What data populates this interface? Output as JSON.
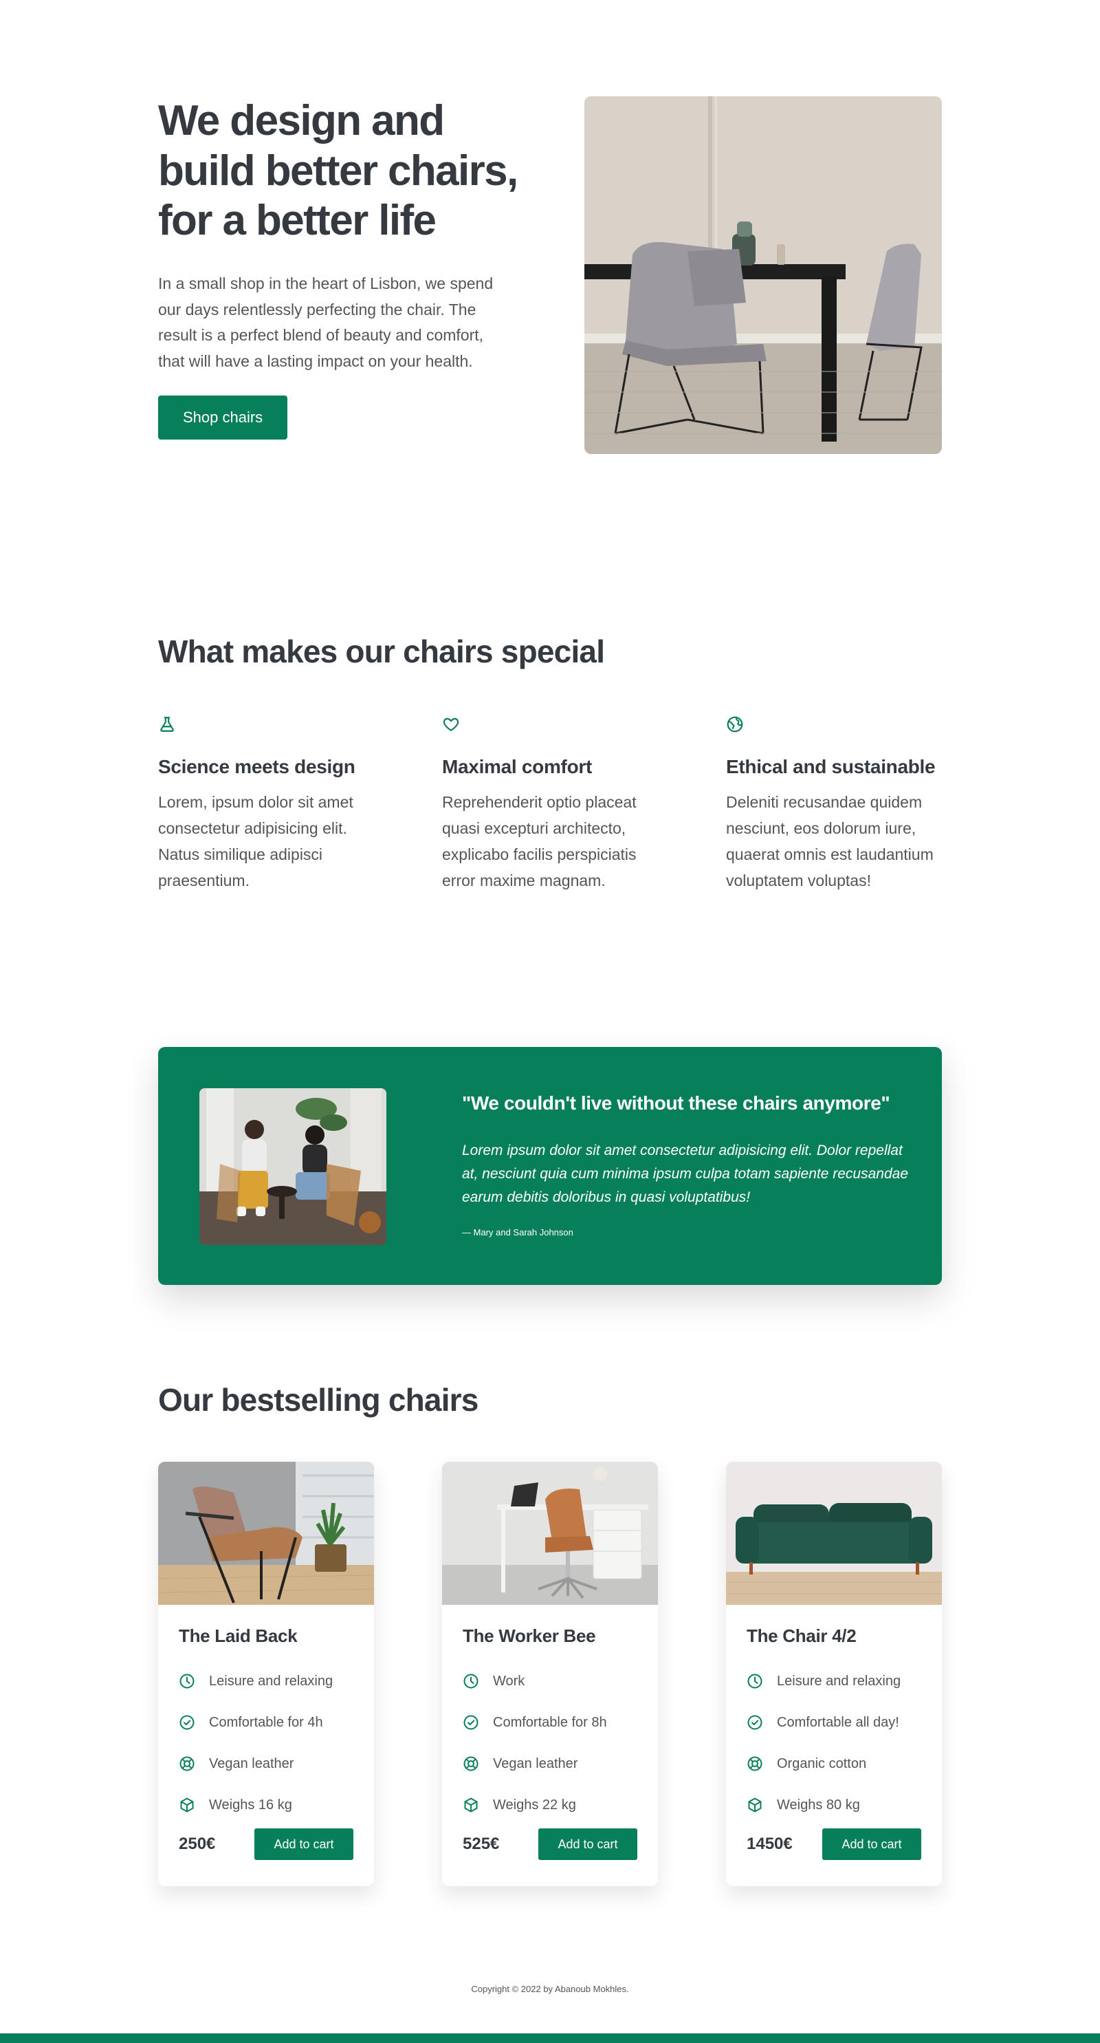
{
  "hero": {
    "title": "We design and build better chairs, for a better life",
    "description": "In a small shop in the heart of Lisbon, we spend our days relentlessly perfecting the chair. The result is a perfect blend of beauty and comfort, that will have a lasting impact on your health.",
    "cta_label": "Shop chairs"
  },
  "features": {
    "title": "What makes our chairs special",
    "items": [
      {
        "icon": "flask-icon",
        "title": "Science meets design",
        "description": "Lorem, ipsum dolor sit amet consectetur adipisicing elit. Natus similique adipisci praesentium."
      },
      {
        "icon": "heart-icon",
        "title": "Maximal comfort",
        "description": "Reprehenderit optio placeat quasi excepturi architecto, explicabo facilis perspiciatis error maxime magnam."
      },
      {
        "icon": "globe-icon",
        "title": "Ethical and sustainable",
        "description": "Deleniti recusandae quidem nesciunt, eos dolorum iure, quaerat omnis est laudantium voluptatem voluptas!"
      }
    ]
  },
  "testimonial": {
    "quote": "\"We couldn't live without these chairs anymore\"",
    "text": "Lorem ipsum dolor sit amet consectetur adipisicing elit. Dolor repellat at, nesciunt quia cum minima ipsum culpa totam sapiente recusandae earum debitis doloribus in quasi voluptatibus!",
    "author": "— Mary and Sarah Johnson"
  },
  "products": {
    "title": "Our bestselling chairs",
    "items": [
      {
        "name": "The Laid Back",
        "attributes": [
          {
            "icon": "clock-icon",
            "text": "Leisure and relaxing"
          },
          {
            "icon": "check-circle-icon",
            "text": "Comfortable for 4h"
          },
          {
            "icon": "lifebuoy-icon",
            "text": "Vegan leather"
          },
          {
            "icon": "cube-icon",
            "text": "Weighs 16 kg"
          }
        ],
        "price": "250€",
        "button_label": "Add to cart"
      },
      {
        "name": "The Worker Bee",
        "attributes": [
          {
            "icon": "clock-icon",
            "text": "Work"
          },
          {
            "icon": "check-circle-icon",
            "text": "Comfortable for 8h"
          },
          {
            "icon": "lifebuoy-icon",
            "text": "Vegan leather"
          },
          {
            "icon": "cube-icon",
            "text": "Weighs 22 kg"
          }
        ],
        "price": "525€",
        "button_label": "Add to cart"
      },
      {
        "name": "The Chair 4/2",
        "attributes": [
          {
            "icon": "clock-icon",
            "text": "Leisure and relaxing"
          },
          {
            "icon": "check-circle-icon",
            "text": "Comfortable all day!"
          },
          {
            "icon": "lifebuoy-icon",
            "text": "Organic cotton"
          },
          {
            "icon": "cube-icon",
            "text": "Weighs 80 kg"
          }
        ],
        "price": "1450€",
        "button_label": "Add to cart"
      }
    ]
  },
  "footer": {
    "copyright": "Copyright © 2022 by Abanoub Mokhles."
  },
  "colors": {
    "accent": "#087f5b",
    "heading": "#343a40",
    "body_text": "#555555",
    "background": "#ffffff"
  }
}
